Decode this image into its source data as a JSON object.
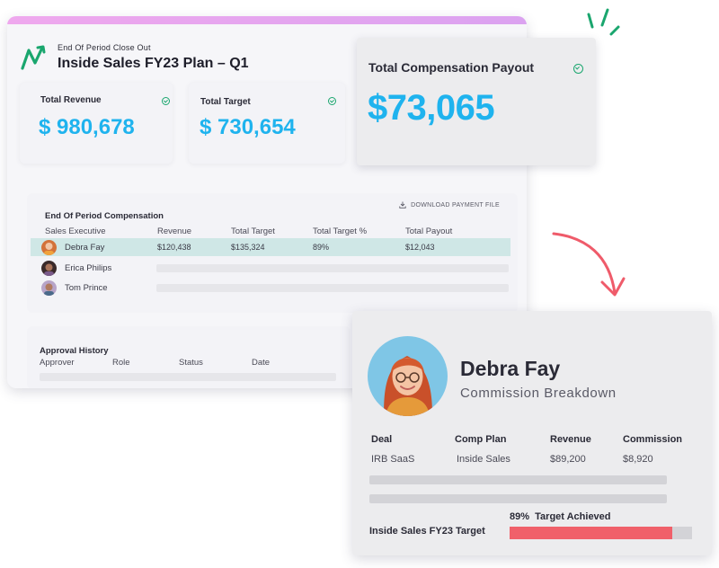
{
  "header": {
    "subtitle": "End Of Period Close Out",
    "title": "Inside Sales FY23 Plan – Q1"
  },
  "cards": {
    "total_revenue": {
      "label": "Total Revenue",
      "value": "$ 980,678"
    },
    "total_target": {
      "label": "Total Target",
      "value": "$ 730,654"
    },
    "total_comp": {
      "label": "Total Compensation Payout",
      "value": "$73,065"
    }
  },
  "comp_table": {
    "title": "End Of Period Compensation",
    "download_label": "DOWNLOAD PAYMENT FILE",
    "columns": [
      "Sales Executive",
      "Revenue",
      "Total Target",
      "Total Target %",
      "Total Payout"
    ],
    "rows": [
      {
        "name": "Debra Fay",
        "revenue": "$120,438",
        "target": "$135,324",
        "target_pct": "89%",
        "payout": "$12,043"
      },
      {
        "name": "Erica Philips"
      },
      {
        "name": "Tom Prince"
      }
    ]
  },
  "approval": {
    "title": "Approval History",
    "columns": [
      "Approver",
      "Role",
      "Status",
      "Date"
    ]
  },
  "breakdown": {
    "name": "Debra Fay",
    "subtitle": "Commission Breakdown",
    "columns": [
      "Deal",
      "Comp Plan",
      "Revenue",
      "Commission"
    ],
    "row": {
      "deal": "IRB SaaS",
      "plan": "Inside Sales",
      "revenue": "$89,200",
      "commission": "$8,920"
    },
    "target_pct_label": "89%",
    "target_achieved_label": "Target Achieved",
    "target_label": "Inside Sales FY23 Target",
    "target_fraction": 0.89
  },
  "colors": {
    "accent_blue": "#1fb3ee",
    "teal_highlight": "#cfe7e6",
    "progress_red": "#f0606a",
    "top_bar": "#e5a6ef",
    "logo_green": "#1aa66e",
    "arrow_pink": "#ef5b6a"
  }
}
